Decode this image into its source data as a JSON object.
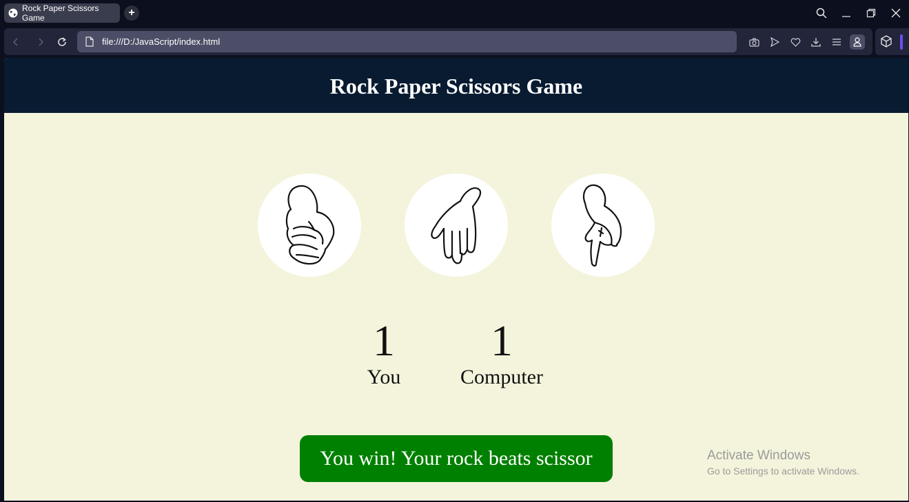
{
  "browser": {
    "tab_title": "Rock Paper Scissors Game",
    "new_tab_label": "+",
    "url": "file:///D:/JavaScript/index.html",
    "icons": [
      "globe-icon",
      "back-icon",
      "forward-icon",
      "reload-icon",
      "file-icon",
      "camera-icon",
      "send-icon",
      "heart-icon",
      "download-icon",
      "menu-icon",
      "profile-icon",
      "extensions-icon",
      "search-icon",
      "minimize-icon",
      "restore-icon",
      "close-icon"
    ],
    "accent_color": "#6b4df5"
  },
  "page": {
    "title": "Rock Paper Scissors Game",
    "header_bg": "#081b31",
    "body_bg": "#f4f4dc",
    "choices": [
      {
        "name": "rock",
        "icon": "rock-hand-icon"
      },
      {
        "name": "paper",
        "icon": "paper-hand-icon"
      },
      {
        "name": "scissors",
        "icon": "scissors-hand-icon"
      }
    ],
    "scores": {
      "user_score": "1",
      "user_label": "You",
      "comp_score": "1",
      "comp_label": "Computer"
    },
    "message": "You win! Your rock beats scissor",
    "message_bg": "#008000"
  },
  "watermark": {
    "line1": "Activate Windows",
    "line2": "Go to Settings to activate Windows."
  }
}
